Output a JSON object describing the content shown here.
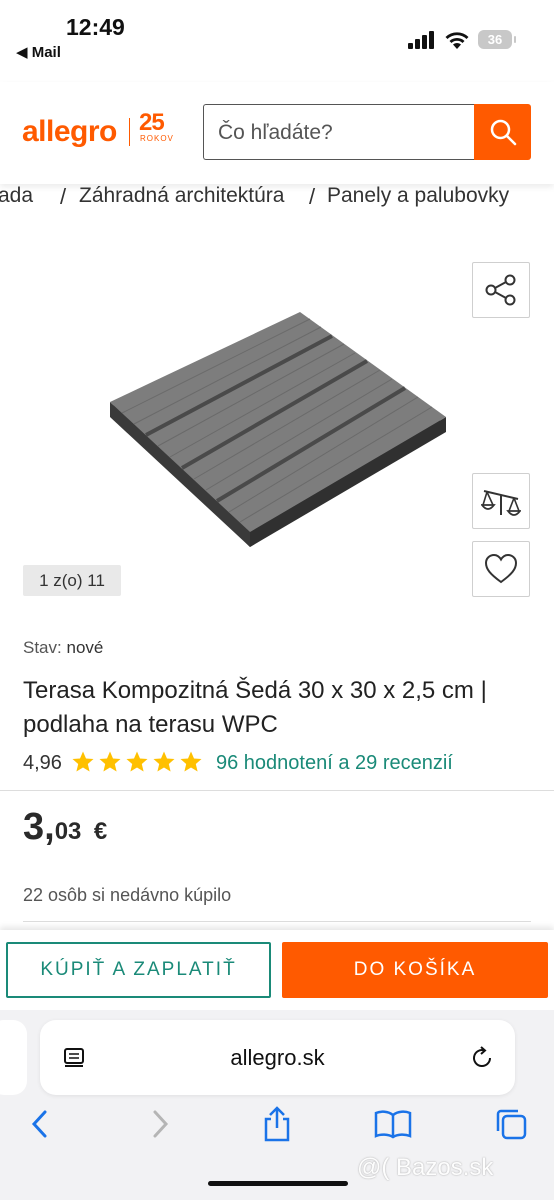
{
  "status_bar": {
    "time": "12:49",
    "back_label": "◀ Mail",
    "battery": "36"
  },
  "header": {
    "logo": "allegro",
    "logo_badge": "25",
    "logo_badge_sub": "ROKOV",
    "search_placeholder": "Čo hľadáte?"
  },
  "breadcrumb": {
    "items": [
      "ada",
      "Záhradná architektúra",
      "Panely a palubovky"
    ],
    "separator": "/"
  },
  "gallery": {
    "counter": "1 z(o) 11"
  },
  "product": {
    "condition_label": "Stav:",
    "condition_value": "nové",
    "title": "Terasa Kompozitná Šedá 30 x 30 x 2,5 cm | podlaha na terasu WPC",
    "rating": "4,96",
    "stars": 5,
    "reviews": "96 hodnotení a 29 recenzií",
    "price_int": "3,",
    "price_dec": "03",
    "price_currency": "€",
    "bought": "22 osôb si nedávno kúpilo"
  },
  "actions": {
    "buy_now": "KÚPIŤ A ZAPLATIŤ",
    "add_to_cart": "DO KOŠÍKA"
  },
  "browser": {
    "url": "allegro.sk",
    "watermark": "@( Bazos.sk"
  },
  "colors": {
    "brand": "#ff5a00",
    "accent": "#1a8a78",
    "star": "#ffc000"
  }
}
